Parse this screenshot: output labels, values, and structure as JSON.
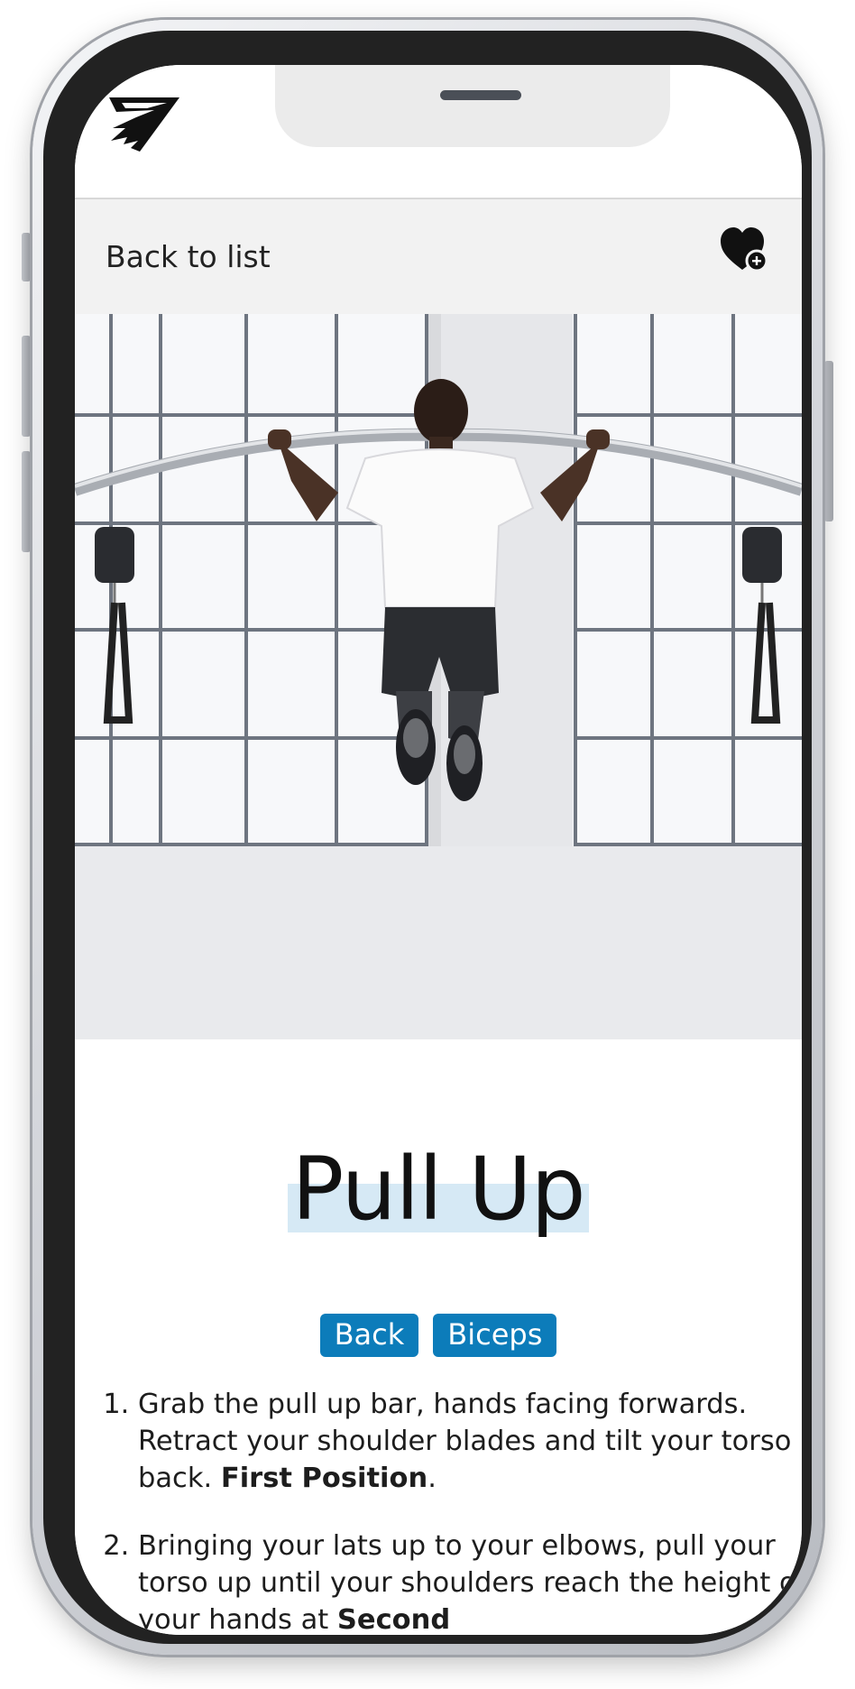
{
  "nav": {
    "back_label": "Back to list"
  },
  "exercise": {
    "title": "Pull Up",
    "tags": [
      "Back",
      "Biceps"
    ],
    "steps": [
      {
        "text": "Grab the pull up bar, hands facing forwards. Retract your shoulder blades and tilt your torso back. ",
        "emphasis": "First Position",
        "tail": "."
      },
      {
        "text": "Bringing your lats up to your elbows, pull your torso up until your shoulders reach the height of your hands at ",
        "emphasis": "Second",
        "tail": ""
      }
    ]
  },
  "colors": {
    "tag_bg": "#0c7cba",
    "title_highlight": "#d6e9f5",
    "subbar_bg": "#f2f2f2"
  },
  "icons": {
    "logo": "brand-shark-logo",
    "favorite": "heart-plus-icon"
  }
}
